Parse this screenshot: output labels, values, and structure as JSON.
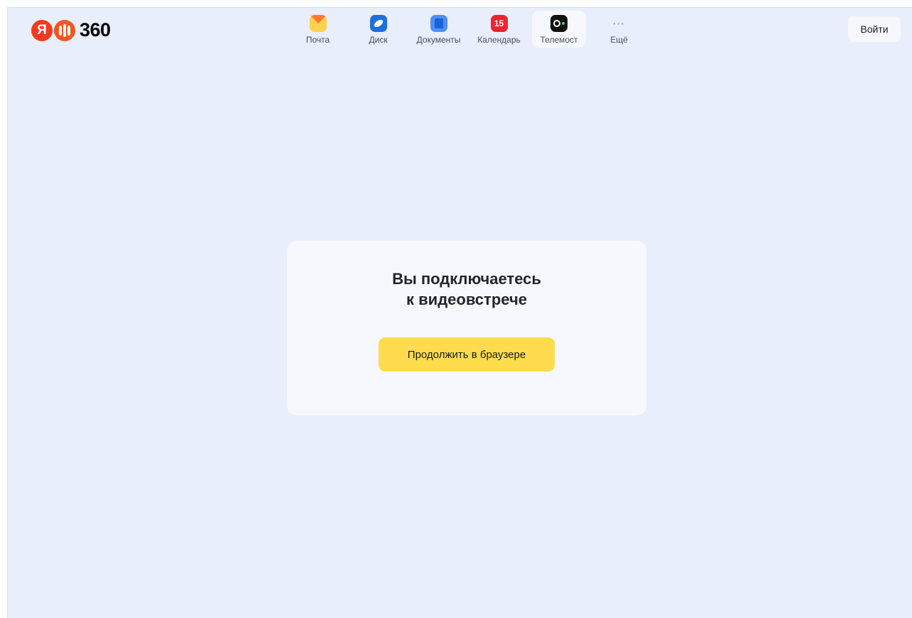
{
  "header": {
    "logo": {
      "letter": "Я",
      "number": "360"
    },
    "nav": [
      {
        "label": "Почта",
        "icon": "mail-icon"
      },
      {
        "label": "Диск",
        "icon": "disk-icon"
      },
      {
        "label": "Документы",
        "icon": "documents-icon"
      },
      {
        "label": "Календарь",
        "icon": "calendar-icon",
        "badge": "15"
      },
      {
        "label": "Телемост",
        "icon": "telemost-icon",
        "active": true
      },
      {
        "label": "Ещё",
        "icon": "more-icon"
      }
    ],
    "login_label": "Войти"
  },
  "card": {
    "title": "Вы подключаетесь\nк видеовстрече",
    "button_label": "Продолжить в браузере"
  },
  "colors": {
    "background": "#e8eefc",
    "accent_button": "#ffdc4d",
    "logo_red": "#f33a1f"
  }
}
